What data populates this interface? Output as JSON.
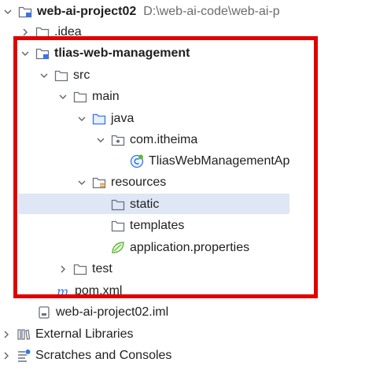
{
  "tree": {
    "project_root": {
      "name": "web-ai-project02",
      "path": "D:\\web-ai-code\\web-ai-p"
    },
    "idea": {
      "name": ".idea"
    },
    "module": {
      "name": "tlias-web-management"
    },
    "src": {
      "name": "src"
    },
    "main": {
      "name": "main"
    },
    "java": {
      "name": "java"
    },
    "package": {
      "name": "com.itheima"
    },
    "app_class": {
      "name": "TliasWebManagementAp"
    },
    "resources": {
      "name": "resources"
    },
    "static": {
      "name": "static"
    },
    "templates": {
      "name": "templates"
    },
    "app_properties": {
      "name": "application.properties"
    },
    "test": {
      "name": "test"
    },
    "pom": {
      "name": "pom.xml"
    },
    "iml": {
      "name": "web-ai-project02.iml"
    },
    "external_libraries": {
      "name": "External Libraries"
    },
    "scratches": {
      "name": "Scratches and Consoles"
    }
  },
  "selected_item": "static",
  "icons": {
    "chevron_down": "chevron-down-icon",
    "chevron_right": "chevron-right-icon",
    "folder": "folder-icon",
    "module": "module-folder-icon",
    "source_root": "source-root-folder-icon",
    "package": "package-icon",
    "spring_class": "spring-boot-class-icon",
    "resources_root": "resources-root-folder-icon",
    "spring_properties": "spring-properties-icon",
    "maven": "maven-icon",
    "iml_file": "iml-file-icon",
    "libraries": "libraries-icon",
    "scratches": "scratches-icon"
  },
  "colors": {
    "selection": "#dfe6f5",
    "annotation_box": "#e00000",
    "folder_stroke": "#6c707e",
    "java_folder": "#3574f0",
    "spring": "#5fb832",
    "maven": "#3574f0"
  }
}
